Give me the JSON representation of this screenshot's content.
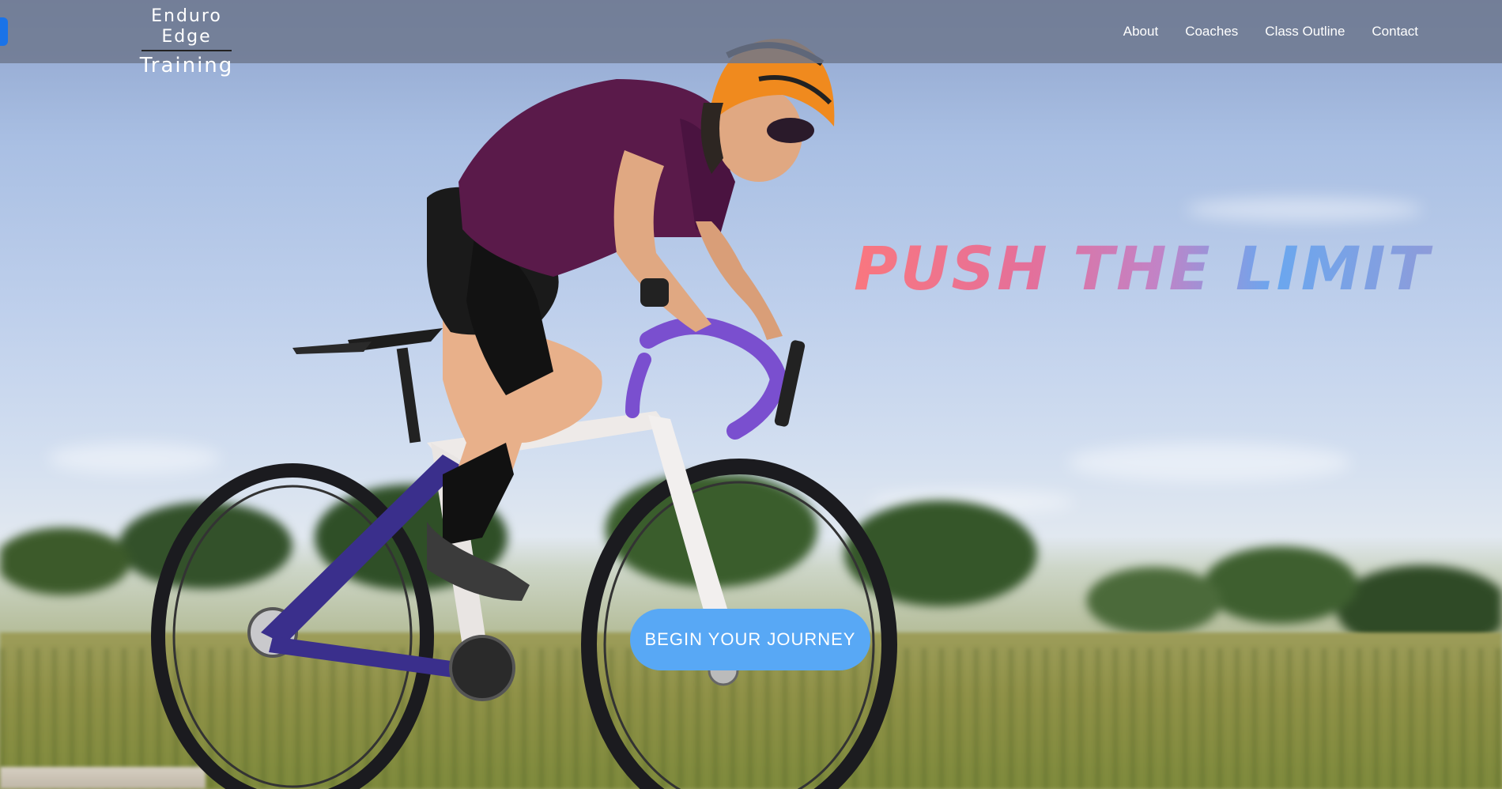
{
  "brand": {
    "line1": "Enduro Edge",
    "line2": "Training"
  },
  "nav": {
    "items": [
      {
        "label": "About"
      },
      {
        "label": "Coaches"
      },
      {
        "label": "Class Outline"
      },
      {
        "label": "Contact"
      }
    ]
  },
  "hero": {
    "headline": "PUSH THE LIMIT",
    "cta_label": "BEGIN YOUR JOURNEY",
    "image_subject": "cyclist-on-road-bike"
  },
  "colors": {
    "navbar_bg": "#6c768c",
    "cta_bg": "#58a8f5",
    "headline_gradient": [
      "#f9777f",
      "#e4709a",
      "#c283c6",
      "#6aa7ef",
      "#8f9bd9"
    ],
    "accent_edge": "#1a73e8"
  }
}
